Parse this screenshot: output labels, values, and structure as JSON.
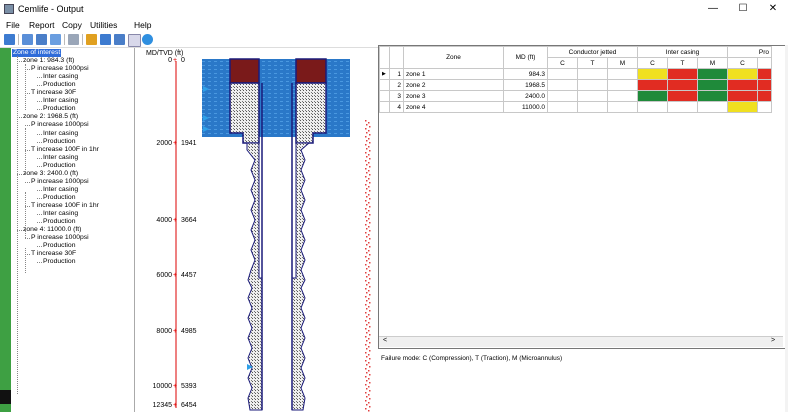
{
  "window": {
    "title": "Cemlife - Output",
    "controls": {
      "minimize": "—",
      "maximize": "☐",
      "close": "✕"
    }
  },
  "menu": [
    "File",
    "Report",
    "Copy",
    "Utilities",
    "Help"
  ],
  "toolbar_icons": [
    "chart-icon",
    "open-icon",
    "save-icon",
    "save-as-icon",
    "grid-icon",
    "bars-icon",
    "calculator-icon",
    "table-icon",
    "edit-icon",
    "help-icon"
  ],
  "tree": {
    "items": [
      {
        "label": "Zone of interest",
        "level": 0,
        "selected": true
      },
      {
        "label": "zone 1: 984.3 (ft)",
        "level": 1
      },
      {
        "label": "P increase 1000psi",
        "level": 2
      },
      {
        "label": "Inter casing",
        "level": 3
      },
      {
        "label": "Production",
        "level": 3
      },
      {
        "label": "T increase 30F",
        "level": 2
      },
      {
        "label": "Inter casing",
        "level": 3
      },
      {
        "label": "Production",
        "level": 3
      },
      {
        "label": "zone 2: 1968.5 (ft)",
        "level": 1
      },
      {
        "label": "P increase 1000psi",
        "level": 2
      },
      {
        "label": "Inter casing",
        "level": 3
      },
      {
        "label": "Production",
        "level": 3
      },
      {
        "label": "T increase 100F in 1hr",
        "level": 2
      },
      {
        "label": "Inter casing",
        "level": 3
      },
      {
        "label": "Production",
        "level": 3
      },
      {
        "label": "zone 3: 2400.0 (ft)",
        "level": 1
      },
      {
        "label": "P increase 1000psi",
        "level": 2
      },
      {
        "label": "Inter casing",
        "level": 3
      },
      {
        "label": "Production",
        "level": 3
      },
      {
        "label": "T increase 100F in 1hr",
        "level": 2
      },
      {
        "label": "Inter casing",
        "level": 3
      },
      {
        "label": "Production",
        "level": 3
      },
      {
        "label": "zone 4: 11000.0 (ft)",
        "level": 1
      },
      {
        "label": "P increase 1000psi",
        "level": 2
      },
      {
        "label": "Production",
        "level": 3
      },
      {
        "label": "T increase 30F",
        "level": 2
      },
      {
        "label": "Production",
        "level": 3
      }
    ]
  },
  "drawing": {
    "header": "MD/TVD (ft)",
    "depths": [
      {
        "md": "0",
        "tvd": "0"
      },
      {
        "md": "2000",
        "tvd": "1941"
      },
      {
        "md": "4000",
        "tvd": "3664"
      },
      {
        "md": "6000",
        "tvd": "4457"
      },
      {
        "md": "8000",
        "tvd": "4985"
      },
      {
        "md": "10000",
        "tvd": "5393"
      },
      {
        "md": "12345",
        "tvd": "6454"
      }
    ],
    "colors": {
      "sea": "#1f6fc0",
      "casing": "#1a1a7a",
      "conductor": "#7a1a1a",
      "cement": "#c8c8c8",
      "formation": "#e04040"
    }
  },
  "grid": {
    "headers": {
      "zone": "Zone",
      "md": "MD (ft)",
      "group1": "Conductor jetted",
      "group2": "Inter casing",
      "group3": "Pro",
      "sub": [
        "C",
        "T",
        "M",
        "C",
        "T",
        "M",
        "C"
      ]
    },
    "rows": [
      {
        "marker": "▶",
        "num": "1",
        "zone": "zone 1",
        "md": "984.3",
        "cells": [
          "",
          "",
          "",
          "Y",
          "R",
          "G",
          "Y"
        ]
      },
      {
        "marker": "",
        "num": "2",
        "zone": "zone 2",
        "md": "1968.5",
        "cells": [
          "",
          "",
          "",
          "R",
          "R",
          "G",
          "R"
        ]
      },
      {
        "marker": "",
        "num": "3",
        "zone": "zone 3",
        "md": "2400.0",
        "cells": [
          "",
          "",
          "",
          "G",
          "R",
          "G",
          "R"
        ]
      },
      {
        "marker": "",
        "num": "4",
        "zone": "zone 4",
        "md": "11000.0",
        "cells": [
          "",
          "",
          "",
          "",
          "",
          "",
          "Y"
        ]
      }
    ],
    "scroll": {
      "left": "<",
      "right": ">"
    }
  },
  "failure_note": "Failure mode: C (Compression), T (Traction), M (Microannulus)"
}
